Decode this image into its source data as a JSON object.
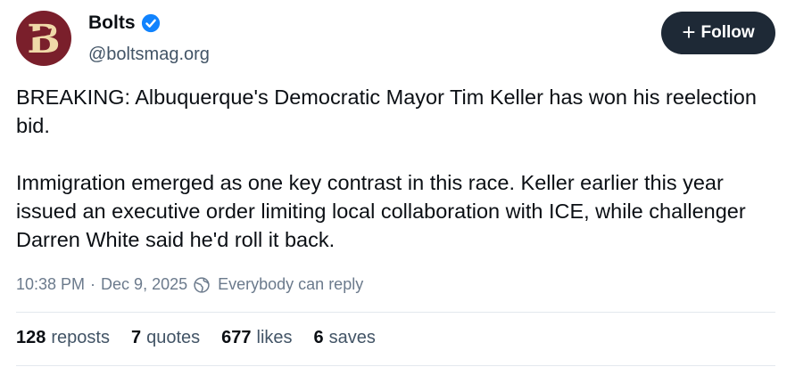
{
  "author": {
    "name": "Bolts",
    "handle": "@boltsmag.org",
    "avatar_letter": "B",
    "avatar_color": "#7a1f2b",
    "avatar_letter_color": "#f0d9a8",
    "verified_color": "#1083fe"
  },
  "follow_button": {
    "label": "Follow",
    "icon": "plus-icon"
  },
  "post": {
    "paragraph1": "BREAKING: Albuquerque's Democratic Mayor Tim Keller has won his reelection bid.",
    "paragraph2": "Immigration emerged as one key contrast in this race. Keller earlier this year issued an executive order limiting local collaboration with ICE, while challenger Darren White said he'd roll it back.",
    "time": "10:38 PM",
    "separator": "·",
    "date": "Dec 9, 2025",
    "reply_setting": "Everybody can reply",
    "reply_icon": "globe-icon"
  },
  "stats": {
    "reposts": {
      "count": "128",
      "label": "reposts"
    },
    "quotes": {
      "count": "7",
      "label": "quotes"
    },
    "likes": {
      "count": "677",
      "label": "likes"
    },
    "saves": {
      "count": "6",
      "label": "saves"
    }
  }
}
